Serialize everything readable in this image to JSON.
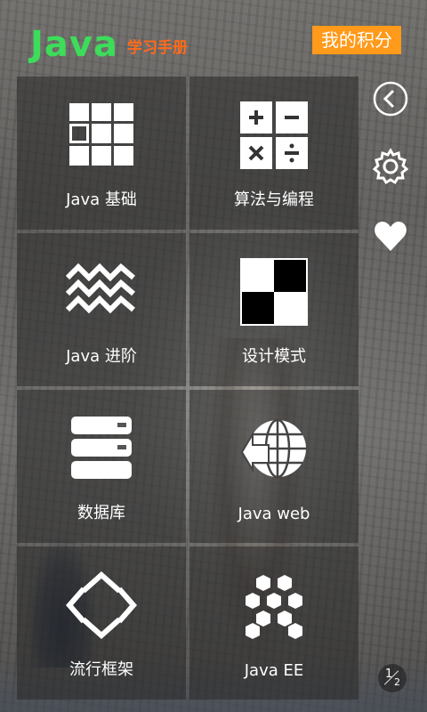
{
  "header": {
    "logo_main": "Java",
    "logo_sub": "学习手册",
    "points_button": "我的积分"
  },
  "tiles": [
    {
      "label": "Java 基础",
      "icon": "grid-icon"
    },
    {
      "label": "算法与编程",
      "icon": "calculator-icon"
    },
    {
      "label": "Java 进阶",
      "icon": "wave-icon"
    },
    {
      "label": "设计模式",
      "icon": "checker-icon"
    },
    {
      "label": "数据库",
      "icon": "database-icon"
    },
    {
      "label": "Java web",
      "icon": "globe-icon"
    },
    {
      "label": "流行框架",
      "icon": "arrows-icon"
    },
    {
      "label": "Java EE",
      "icon": "hexagon-icon"
    }
  ],
  "side": {
    "icons": [
      "back-icon",
      "gear-icon",
      "heart-icon"
    ]
  },
  "pager": {
    "current": "1",
    "total": "2"
  }
}
